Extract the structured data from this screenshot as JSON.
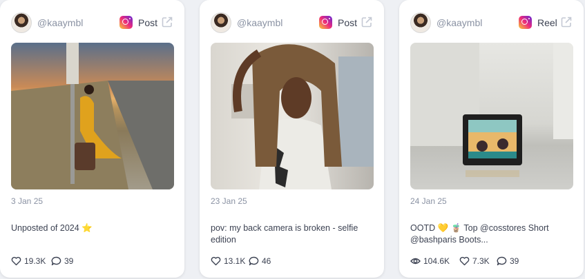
{
  "cards": [
    {
      "handle": "@kaaymbl",
      "platform_icon": "instagram-icon",
      "post_type": "Post",
      "date": "3 Jan 25",
      "caption": "Unposted of 2024 ⭐",
      "likes": "19.3K",
      "comments": "39"
    },
    {
      "handle": "@kaaymbl",
      "platform_icon": "instagram-icon",
      "post_type": "Post",
      "date": "23 Jan 25",
      "caption": "pov: my back camera is broken - selfie edition",
      "likes": "13.1K",
      "comments": "46"
    },
    {
      "handle": "@kaaymbl",
      "platform_icon": "instagram-icon",
      "post_type": "Reel",
      "date": "24 Jan 25",
      "caption": "OOTD 💛 🧋 Top @cosstores Short @bashparis Boots...",
      "views": "104.6K",
      "likes": "7.3K",
      "comments": "39"
    }
  ],
  "colors": {
    "muted_text": "#8a92a3",
    "body_text": "#3c4252",
    "card_bg": "#ffffff",
    "page_bg": "#eef0f4"
  }
}
